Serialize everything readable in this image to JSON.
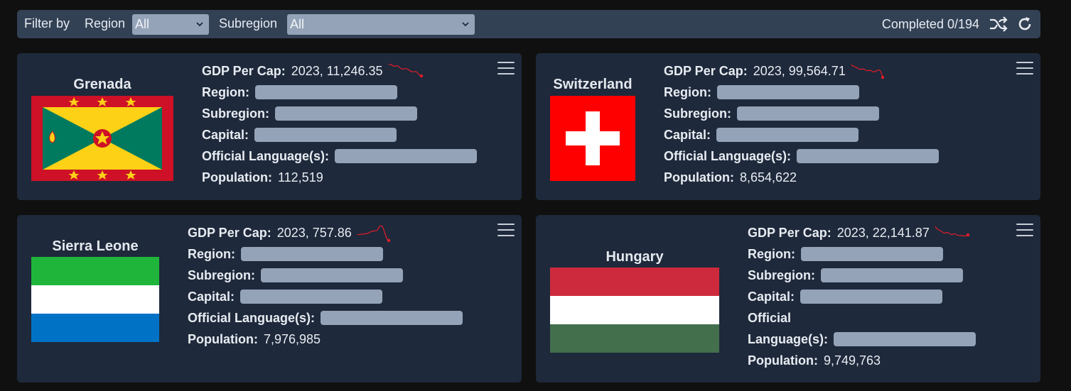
{
  "filter_bar": {
    "filter_by_label": "Filter by",
    "region_label": "Region",
    "region_value": "All",
    "subregion_label": "Subregion",
    "subregion_value": "All",
    "completed_text": "Completed 0/194",
    "shuffle_icon": "shuffle-icon",
    "refresh_icon": "refresh-icon"
  },
  "labels": {
    "gdp": "GDP Per Cap:",
    "region": "Region:",
    "subregion": "Subregion:",
    "capital": "Capital:",
    "languages": "Official Language(s):",
    "languages_line1": "Official",
    "languages_line2": "Language(s):",
    "population": "Population:"
  },
  "cards": [
    {
      "name": "Grenada",
      "gdp_value": "2023, 11,246.35",
      "population": "112,519",
      "flag": "grenada-flag"
    },
    {
      "name": "Switzerland",
      "gdp_value": "2023, 99,564.71",
      "population": "8,654,622",
      "flag": "switzerland-flag"
    },
    {
      "name": "Sierra Leone",
      "gdp_value": "2023, 757.86",
      "population": "7,976,985",
      "flag": "sierra-leone-flag"
    },
    {
      "name": "Hungary",
      "gdp_value": "2023, 22,141.87",
      "population": "9,749,763",
      "flag": "hungary-flag"
    }
  ],
  "colors": {
    "background": "#101010",
    "card": "#1e293b",
    "filter_bar": "#334155",
    "redacted": "#94a3b8",
    "sparkline": "#e11d2a"
  }
}
